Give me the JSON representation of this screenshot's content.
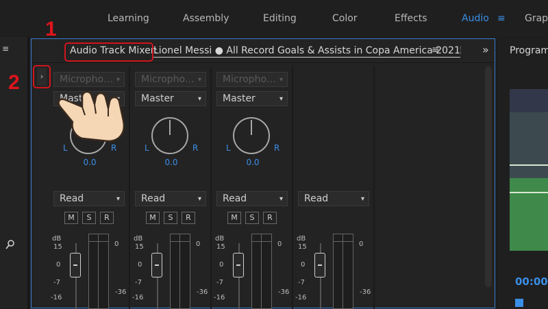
{
  "workspaces": [
    "Learning",
    "Assembly",
    "Editing",
    "Color",
    "Effects",
    "Audio",
    "Grap"
  ],
  "active_workspace": "Audio",
  "mixer": {
    "title": "Audio Track Mixer:",
    "sequence": "Lionel Messi ● All Record Goals & Assists in Copa America 2021",
    "menu_icon": "≡",
    "more_icon": "»",
    "expander_icon": "›",
    "channels": [
      {
        "input": "Micropho…",
        "output": "Master",
        "pan": "0.0",
        "automation": "Read"
      },
      {
        "input": "Micropho…",
        "output": "Master",
        "pan": "0.0",
        "automation": "Read"
      },
      {
        "input": "Micropho…",
        "output": "Master",
        "pan": "0.0",
        "automation": "Read"
      },
      {
        "automation": "Read"
      }
    ],
    "pan_left": "L",
    "pan_right": "R",
    "buttons": {
      "mute": "M",
      "solo": "S",
      "record": "R"
    },
    "fader_scale": {
      "unit": "dB",
      "marks": [
        "15",
        "0",
        "-7",
        "-16"
      ]
    },
    "meter_scale": {
      "top": "0",
      "bottom": "-36"
    }
  },
  "program": {
    "title": "Program",
    "timecode": "00:00"
  },
  "callouts": {
    "one": "1",
    "two": "2"
  },
  "colors": {
    "accent": "#3a8ee6",
    "highlight": "#d0151c"
  }
}
